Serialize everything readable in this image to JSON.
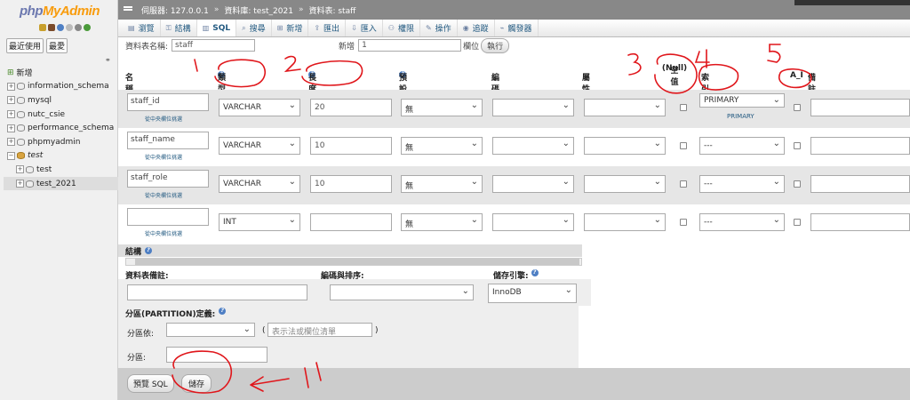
{
  "sidebar": {
    "logo_a": "php",
    "logo_b": "MyAdmin",
    "recent": "最近使用",
    "favorites": "最愛",
    "tree": [
      {
        "label": "新增",
        "type": "new"
      },
      {
        "label": "information_schema",
        "type": "db"
      },
      {
        "label": "mysql",
        "type": "db"
      },
      {
        "label": "nutc_csie",
        "type": "db"
      },
      {
        "label": "performance_schema",
        "type": "db"
      },
      {
        "label": "phpmyadmin",
        "type": "db"
      },
      {
        "label": "test",
        "type": "db-open"
      },
      {
        "label": "test",
        "type": "table"
      },
      {
        "label": "test_2021",
        "type": "table-sel"
      }
    ]
  },
  "breadcrumb": {
    "server": "伺服器: 127.0.0.1",
    "database": "資料庫: test_2021",
    "table": "資料表: staff"
  },
  "tabs": [
    "瀏覽",
    "結構",
    "SQL",
    "搜尋",
    "新增",
    "匯出",
    "匯入",
    "權限",
    "操作",
    "追蹤",
    "觸發器"
  ],
  "form": {
    "table_name_label": "資料表名稱:",
    "table_name_value": "staff",
    "add_label": "新增",
    "add_value": "1",
    "column_label": "欄位",
    "go_button": "執行"
  },
  "columns": {
    "name": "名稱",
    "type": "類型",
    "length": "長度 / 值",
    "default": "預設值",
    "collation": "編碼與排序",
    "attributes": "屬性",
    "null_line1": "空值",
    "null_line2": "(Null)",
    "index": "索引",
    "ai": "A_I",
    "comment": "備註"
  },
  "rows": [
    {
      "name": "staff_id",
      "type": "VARCHAR",
      "length": "20",
      "default": "無",
      "index": "PRIMARY",
      "index_note": "PRIMARY"
    },
    {
      "name": "staff_name",
      "type": "VARCHAR",
      "length": "10",
      "default": "無",
      "index": "---",
      "index_note": ""
    },
    {
      "name": "staff_role",
      "type": "VARCHAR",
      "length": "10",
      "default": "無",
      "index": "---",
      "index_note": ""
    },
    {
      "name": "",
      "type": "INT",
      "length": "",
      "default": "無",
      "index": "---",
      "index_note": ""
    }
  ],
  "pick_central": "從中央欄位挑選",
  "structure_label": "結構",
  "table_comment_label": "資料表備註:",
  "collation_label": "編碼與排序:",
  "engine_label": "儲存引擎:",
  "engine_value": "InnoDB",
  "partition_label": "分區(PARTITION)定義:",
  "partition_by_label": "分區依:",
  "partition_expr_placeholder": "表示法或欄位清單",
  "partitions_label": "分區:",
  "preview_sql_button": "預覽 SQL",
  "save_button": "儲存",
  "annotations": [
    "1",
    "2",
    "3",
    "4",
    "5"
  ],
  "colors": {
    "annotation": "#e0161b",
    "link": "#235a81"
  }
}
